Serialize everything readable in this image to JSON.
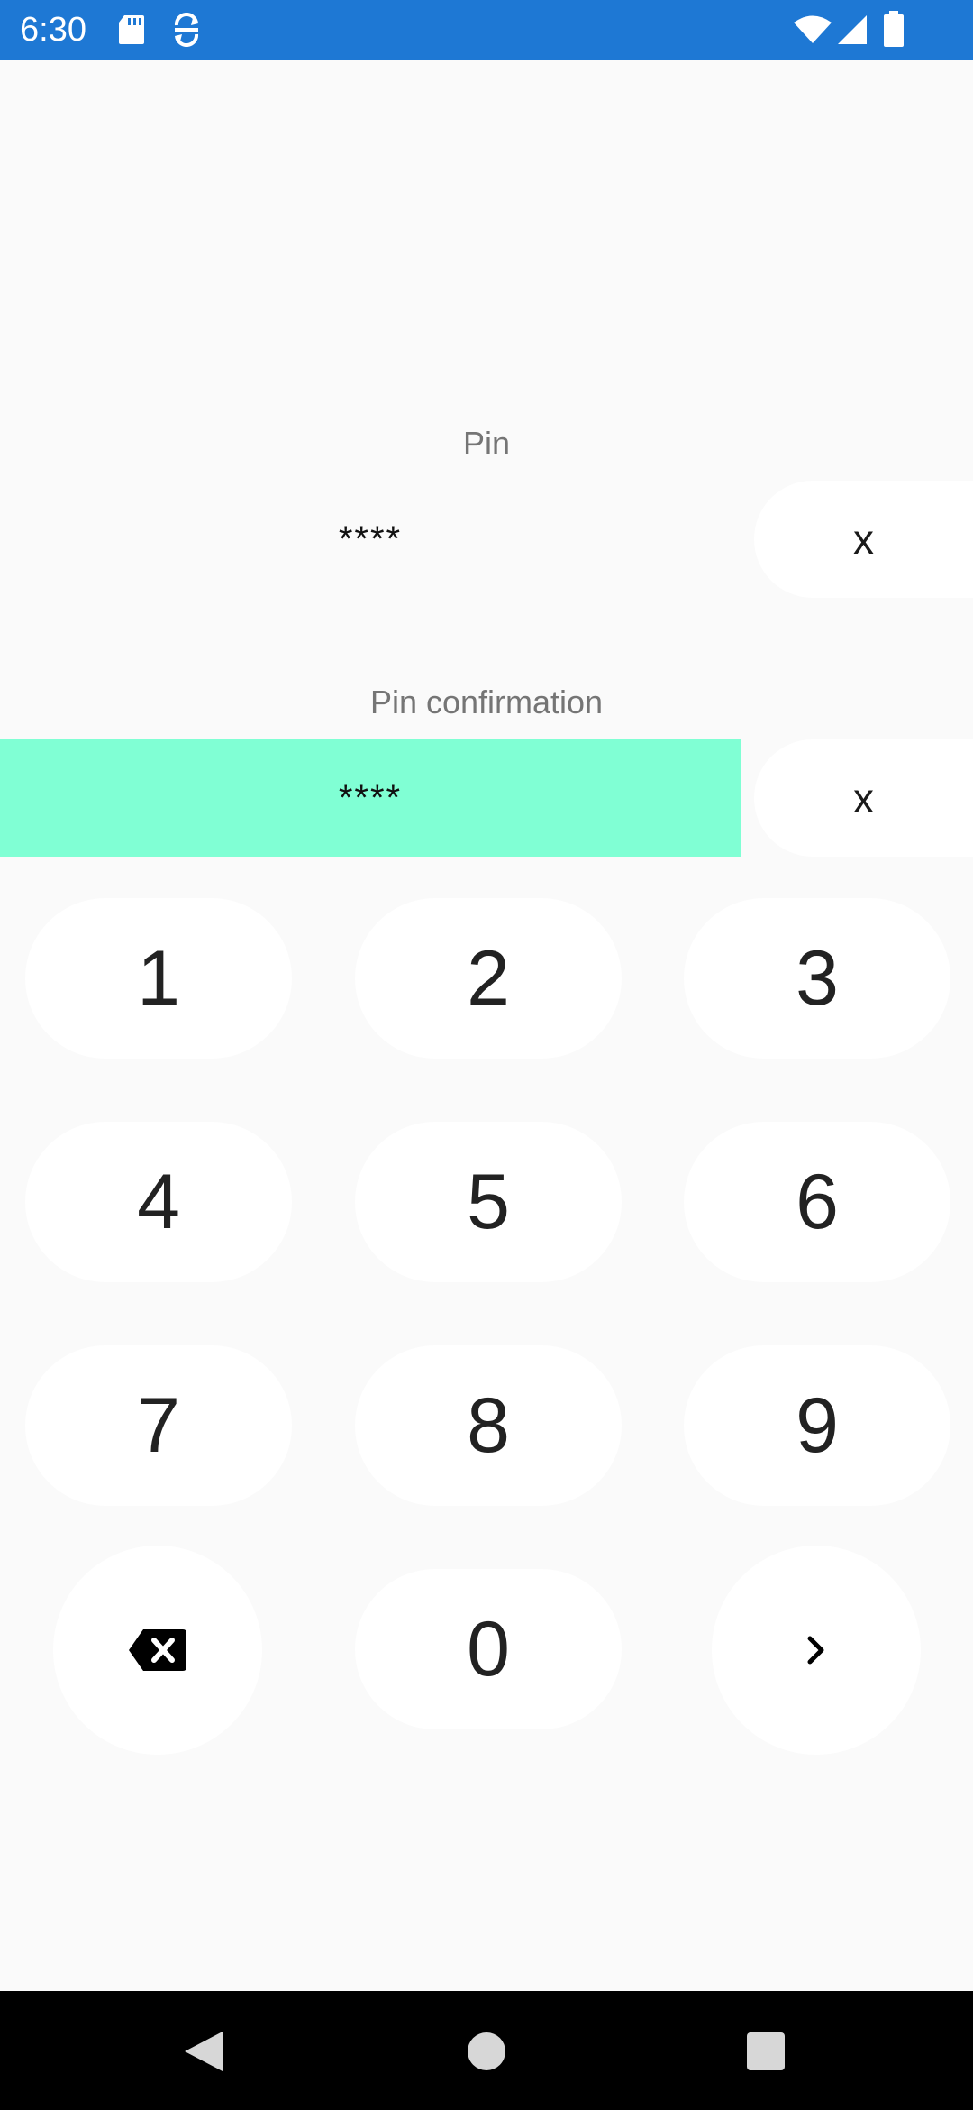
{
  "status_bar": {
    "time": "6:30",
    "icons": [
      "sd-card-icon",
      "sync-icon",
      "wifi-icon",
      "signal-icon",
      "battery-icon"
    ],
    "background": "#1e78d4"
  },
  "pin": {
    "label": "Pin",
    "value": "****",
    "clear_label": "x"
  },
  "pin_confirmation": {
    "label": "Pin confirmation",
    "value": "****",
    "clear_label": "x",
    "highlight_color": "#80ffd4"
  },
  "keypad": {
    "keys": [
      "1",
      "2",
      "3",
      "4",
      "5",
      "6",
      "7",
      "8",
      "9"
    ],
    "zero": "0",
    "backspace_icon": "backspace-icon",
    "next_icon": "chevron-right-icon"
  },
  "nav_bar": {
    "buttons": [
      "back-icon",
      "home-icon",
      "recents-icon"
    ]
  }
}
